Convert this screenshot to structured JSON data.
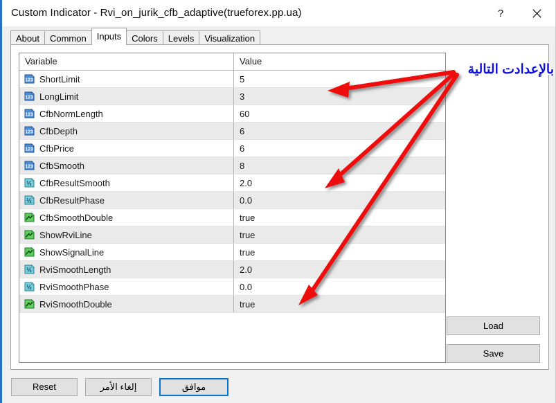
{
  "window": {
    "title": "Custom Indicator - Rvi_on_jurik_cfb_adaptive(trueforex.pp.ua)",
    "help_icon": "question-mark-icon",
    "close_icon": "close-icon",
    "accent_color": "#2b6fc2"
  },
  "tabs": [
    {
      "label": "About",
      "active": false
    },
    {
      "label": "Common",
      "active": false
    },
    {
      "label": "Inputs",
      "active": true
    },
    {
      "label": "Colors",
      "active": false
    },
    {
      "label": "Levels",
      "active": false
    },
    {
      "label": "Visualization",
      "active": false
    }
  ],
  "table": {
    "columns": [
      "Variable",
      "Value"
    ],
    "rows": [
      {
        "icon": "integer-type-icon",
        "variable": "ShortLimit",
        "value": "5"
      },
      {
        "icon": "integer-type-icon",
        "variable": "LongLimit",
        "value": "3"
      },
      {
        "icon": "integer-type-icon",
        "variable": "CfbNormLength",
        "value": "60"
      },
      {
        "icon": "integer-type-icon",
        "variable": "CfbDepth",
        "value": "6"
      },
      {
        "icon": "integer-type-icon",
        "variable": "CfbPrice",
        "value": "6"
      },
      {
        "icon": "integer-type-icon",
        "variable": "CfbSmooth",
        "value": "8"
      },
      {
        "icon": "double-type-icon",
        "variable": "CfbResultSmooth",
        "value": "2.0"
      },
      {
        "icon": "double-type-icon",
        "variable": "CfbResultPhase",
        "value": "0.0"
      },
      {
        "icon": "boolean-type-icon",
        "variable": "CfbSmoothDouble",
        "value": "true"
      },
      {
        "icon": "boolean-type-icon",
        "variable": "ShowRviLine",
        "value": "true"
      },
      {
        "icon": "boolean-type-icon",
        "variable": "ShowSignalLine",
        "value": "true"
      },
      {
        "icon": "double-type-icon",
        "variable": "RviSmoothLength",
        "value": "2.0"
      },
      {
        "icon": "double-type-icon",
        "variable": "RviSmoothPhase",
        "value": "0.0"
      },
      {
        "icon": "boolean-type-icon",
        "variable": "RviSmoothDouble",
        "value": "true"
      }
    ]
  },
  "side_panel": {
    "load_label": "Load",
    "save_label": "Save"
  },
  "bottom_bar": {
    "reset_label": "Reset",
    "cancel_label": "إلغاء الأمر",
    "ok_label": "موافق"
  },
  "annotation": {
    "text": "بالإعدادت التالية",
    "text_color": "#1010d8",
    "arrow_color": "#ee1111"
  }
}
